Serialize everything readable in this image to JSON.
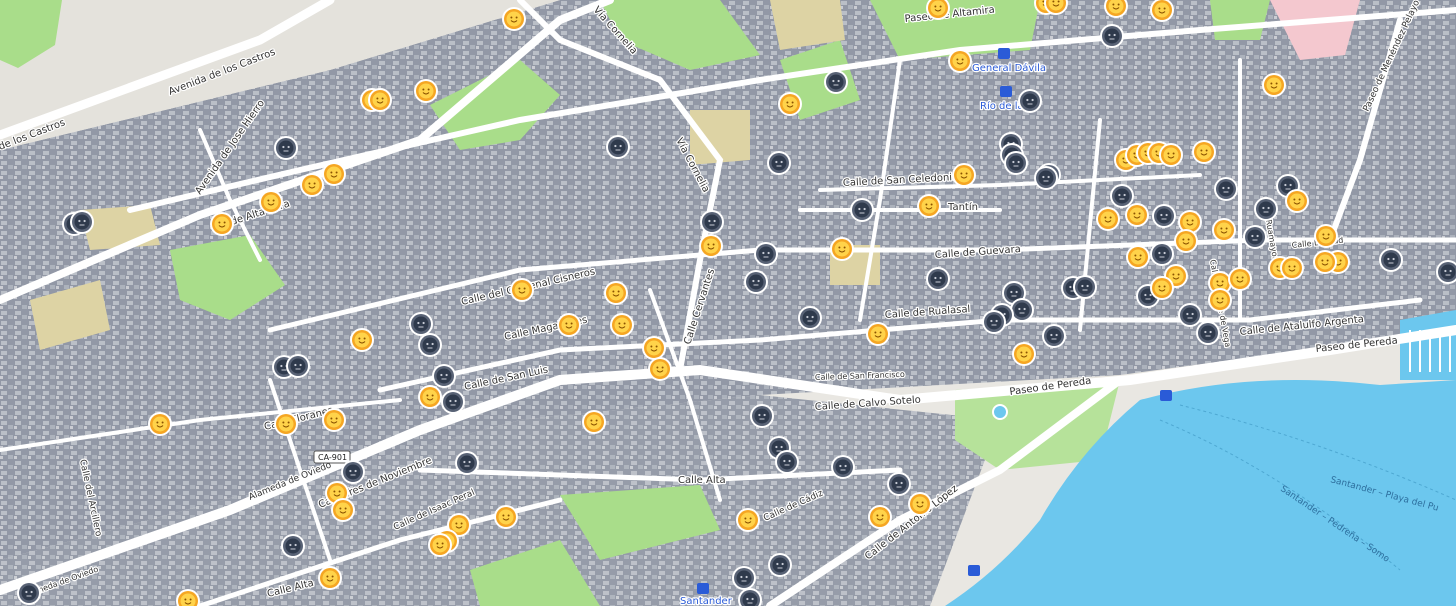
{
  "colors": {
    "land": "#e9e7e2",
    "building": "#7b8395",
    "building_light": "#9aa1ae",
    "road": "#ffffff",
    "park": "#a9dd8a",
    "water": "#6cc7ee",
    "sand": "#ddd3a4",
    "marker_happy": "#f5a623",
    "marker_happy_face": "#ffd34a",
    "marker_dark": "#2f3a4c",
    "marker_ring": "#ffffff",
    "transit": "#2a5bd7"
  },
  "marker_types": {
    "happy": "happy-face-icon",
    "dark": "dark-face-icon",
    "transit": "transit-station-icon"
  },
  "streets": [
    "Avenida de los Castros",
    "de los Castros",
    "Avenida de Jose Hierro",
    "de Alta mira",
    "Paseo de Altamira",
    "Vía Cornelia",
    "Vía Cornelia",
    "Calle de San Celedonio",
    "Tantín",
    "Calle de Guevara",
    "Calle del Cardenal Cisneros",
    "Calle Magallanes",
    "Calle Cervantes",
    "Calle de Rualasal",
    "Calle de San Luis",
    "Calle de San Francisco",
    "Calle de Calvo Sotelo",
    "Paseo de Pereda",
    "Paseo de Pereda",
    "Calle de Lope de Vega",
    "Calle Lealtad",
    "Calle de Atalulfo Argenta",
    "Paseo de Menéndez Pelayo",
    "Calle Floranes",
    "Calle del Arcillero",
    "Alameda de Oviedo",
    "Calle Tres de Noviembre",
    "Calle de Isaac Peral",
    "Calle Alta",
    "Calle Alta",
    "Calle de Cádiz",
    "Calle de Antonio López",
    "Alameda de Oviedo",
    "Calle Ruamayor"
  ],
  "pois": {
    "general_davila": "General Dávila",
    "rio_de_la_pila": "Río de la",
    "santander": "Santander"
  },
  "road_shield": "CA-901",
  "water_labels": [
    "Santander – Pedreña – Somo",
    "Santander – Playa del Pu"
  ]
}
